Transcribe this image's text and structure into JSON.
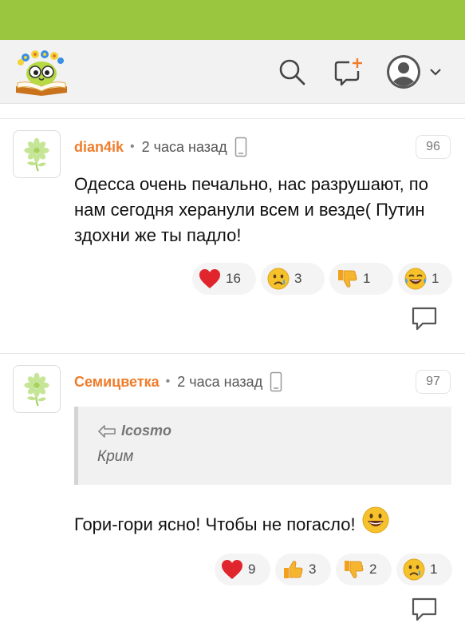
{
  "colors": {
    "accent_bar": "#9ac53f",
    "author": "#f07c2a",
    "header_bg": "#f2f2f2"
  },
  "header": {
    "logo": "book-owl-logo",
    "icons": [
      "search-icon",
      "add-comment-icon",
      "profile-avatar-icon",
      "chevron-down-icon"
    ]
  },
  "comments": [
    {
      "author": "dian4ik",
      "separator": "•",
      "time": "2 часа назад",
      "number": "96",
      "text": "Одесса очень печально, нас разрушают, по нам сегодня херанули всем и везде( Путин здохни же ты падло!",
      "reactions": [
        {
          "icon": "heart-icon",
          "count": "16"
        },
        {
          "icon": "crying-face-icon",
          "count": "3"
        },
        {
          "icon": "thumbs-down-icon",
          "count": "1"
        },
        {
          "icon": "laughing-tears-icon",
          "count": "1"
        }
      ]
    },
    {
      "author": "Семицветка",
      "separator": "•",
      "time": "2 часа назад",
      "number": "97",
      "quote": {
        "author": "Icosmo",
        "text": "Крим"
      },
      "text": "Гори-гори ясно! Чтобы не погасло!",
      "reactions": [
        {
          "icon": "heart-icon",
          "count": "9"
        },
        {
          "icon": "thumbs-up-icon",
          "count": "3"
        },
        {
          "icon": "thumbs-down-icon",
          "count": "2"
        },
        {
          "icon": "crying-face-icon",
          "count": "1"
        }
      ]
    }
  ]
}
